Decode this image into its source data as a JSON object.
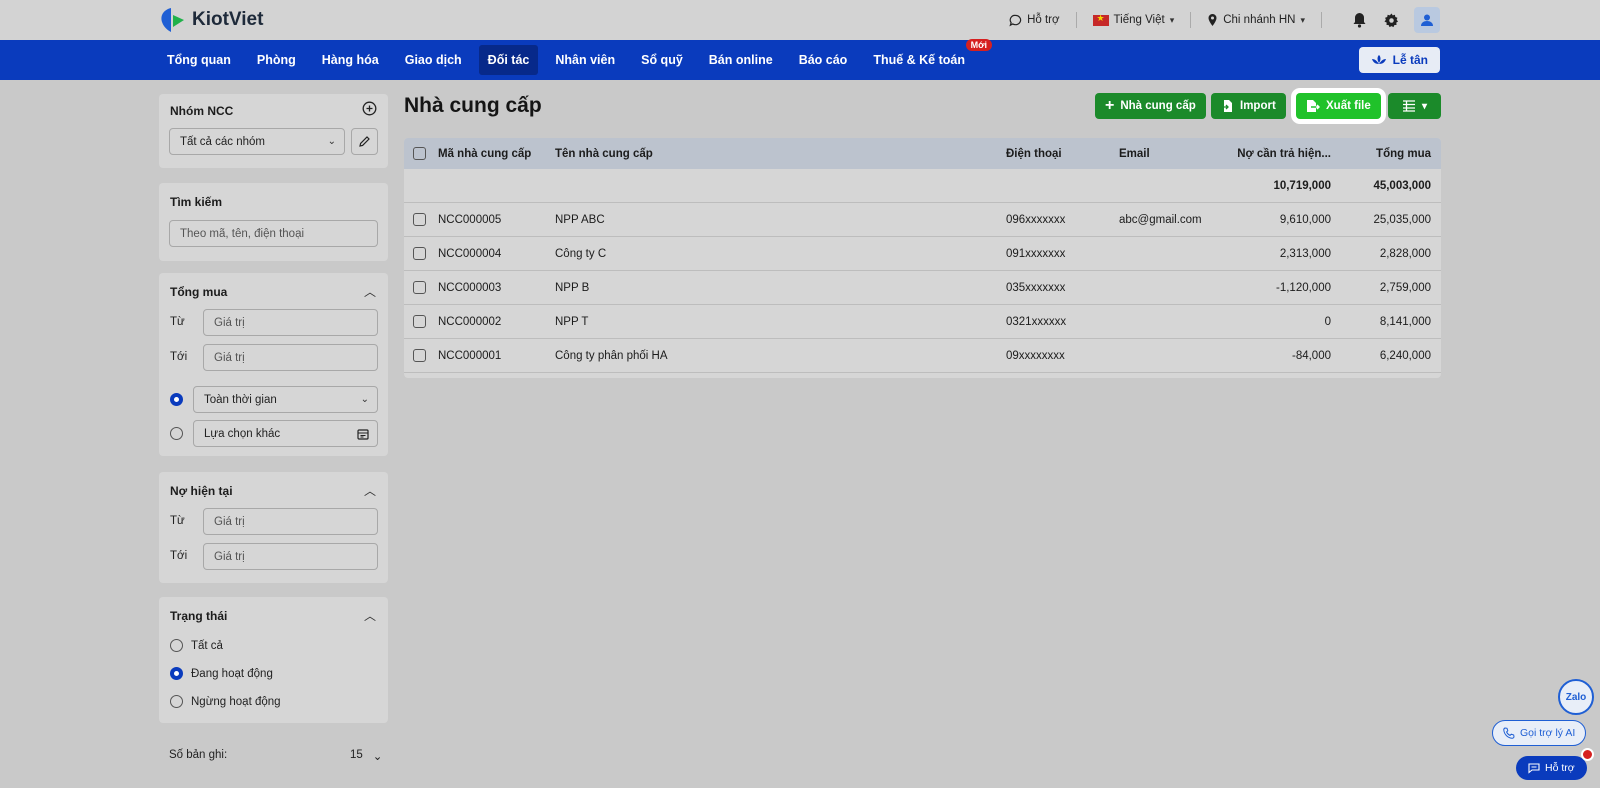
{
  "app": {
    "name": "KiotViet"
  },
  "topbar": {
    "support": "Hỗ trợ",
    "language": "Tiếng Việt",
    "branch": "Chi nhánh HN"
  },
  "nav": {
    "items": [
      "Tổng quan",
      "Phòng",
      "Hàng hóa",
      "Giao dịch",
      "Đối tác",
      "Nhân viên",
      "Sổ quỹ",
      "Bán online",
      "Báo cáo",
      "Thuế & Kế toán"
    ],
    "new_badge": "Mới",
    "reception": "Lễ tân"
  },
  "sidebar": {
    "group": {
      "title": "Nhóm NCC",
      "value": "Tất cả các nhóm"
    },
    "search": {
      "title": "Tìm kiếm",
      "placeholder": "Theo mã, tên, điện thoại"
    },
    "total_purchase": {
      "title": "Tổng mua",
      "from_label": "Từ",
      "to_label": "Tới",
      "value_placeholder": "Giá trị",
      "time_option": "Toàn thời gian",
      "other_option": "Lựa chọn khác"
    },
    "current_debt": {
      "title": "Nợ hiện tại",
      "from_label": "Từ",
      "to_label": "Tới",
      "value_placeholder": "Giá trị"
    },
    "status": {
      "title": "Trạng thái",
      "options": [
        "Tất cả",
        "Đang hoạt động",
        "Ngừng hoạt động"
      ],
      "selected": 1
    },
    "records_label": "Số bản ghi:",
    "records_value": "15"
  },
  "main": {
    "title": "Nhà cung cấp",
    "buttons": {
      "add": "Nhà cung cấp",
      "import": "Import",
      "export": "Xuất file"
    },
    "columns": [
      "Mã nhà cung cấp",
      "Tên nhà cung cấp",
      "Điện thoại",
      "Email",
      "Nợ cần trả hiện...",
      "Tổng mua"
    ],
    "totals": {
      "debt": "10,719,000",
      "purchase": "45,003,000"
    },
    "rows": [
      {
        "code": "NCC000005",
        "name": "NPP ABC",
        "phone": "096xxxxxxx",
        "email": "abc@gmail.com",
        "debt": "9,610,000",
        "purchase": "25,035,000"
      },
      {
        "code": "NCC000004",
        "name": "Công ty C",
        "phone": "091xxxxxxx",
        "email": "",
        "debt": "2,313,000",
        "purchase": "2,828,000"
      },
      {
        "code": "NCC000003",
        "name": "NPP B",
        "phone": "035xxxxxxx",
        "email": "",
        "debt": "-1,120,000",
        "purchase": "2,759,000"
      },
      {
        "code": "NCC000002",
        "name": "NPP T",
        "phone": "0321xxxxxx",
        "email": "",
        "debt": "0",
        "purchase": "8,141,000"
      },
      {
        "code": "NCC000001",
        "name": "Công ty phân phối HA",
        "phone": "09xxxxxxxx",
        "email": "",
        "debt": "-84,000",
        "purchase": "6,240,000"
      }
    ]
  },
  "floating": {
    "zalo": "Zalo",
    "ai_assistant": "Gọi trợ lý AI",
    "help": "Hỗ trợ"
  }
}
